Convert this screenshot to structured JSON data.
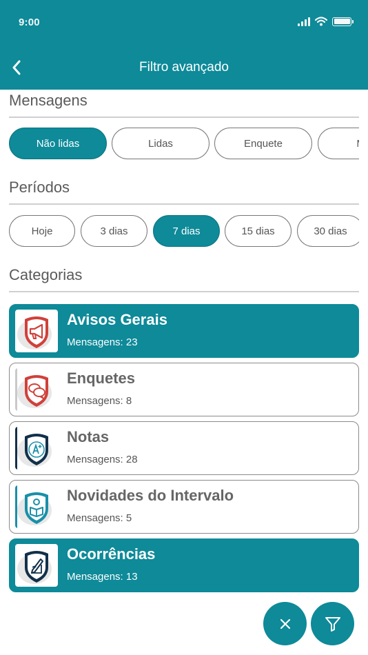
{
  "status_bar": {
    "time": "9:00"
  },
  "header": {
    "title": "Filtro avançado"
  },
  "sections": {
    "messages": {
      "title": "Mensagens",
      "chips": [
        {
          "label": "Não lidas",
          "selected": true
        },
        {
          "label": "Lidas",
          "selected": false
        },
        {
          "label": "Enquete",
          "selected": false
        },
        {
          "label": "Men",
          "selected": false
        }
      ]
    },
    "periods": {
      "title": "Períodos",
      "chips": [
        {
          "label": "Hoje",
          "selected": false
        },
        {
          "label": "3 dias",
          "selected": false
        },
        {
          "label": "7 dias",
          "selected": true
        },
        {
          "label": "15 dias",
          "selected": false
        },
        {
          "label": "30 dias",
          "selected": false
        }
      ]
    },
    "categories": {
      "title": "Categorias",
      "items": [
        {
          "name": "Avisos Gerais",
          "count": "Mensagens: 23",
          "selected": true,
          "icon": "megaphone-icon",
          "icon_color": "#d0413a"
        },
        {
          "name": "Enquetes",
          "count": "Mensagens: 8",
          "selected": false,
          "icon": "speech-bubbles-icon",
          "icon_color": "#d0413a"
        },
        {
          "name": "Notas",
          "count": "Mensagens: 28",
          "selected": false,
          "icon": "grade-a-plus-icon",
          "icon_color": "#12304a"
        },
        {
          "name": "Novidades do Intervalo",
          "count": "Mensagens: 5",
          "selected": false,
          "icon": "reading-student-icon",
          "icon_color": "#1a8fa8"
        },
        {
          "name": "Ocorrências",
          "count": "Mensagens: 13",
          "selected": true,
          "icon": "pen-writing-icon",
          "icon_color": "#12304a"
        }
      ]
    }
  },
  "colors": {
    "primary": "#0e8a99",
    "chip_border": "#777777",
    "text_gray": "#5a5a5a"
  },
  "actions": {
    "clear_icon": "close-icon",
    "apply_icon": "filter-icon"
  }
}
